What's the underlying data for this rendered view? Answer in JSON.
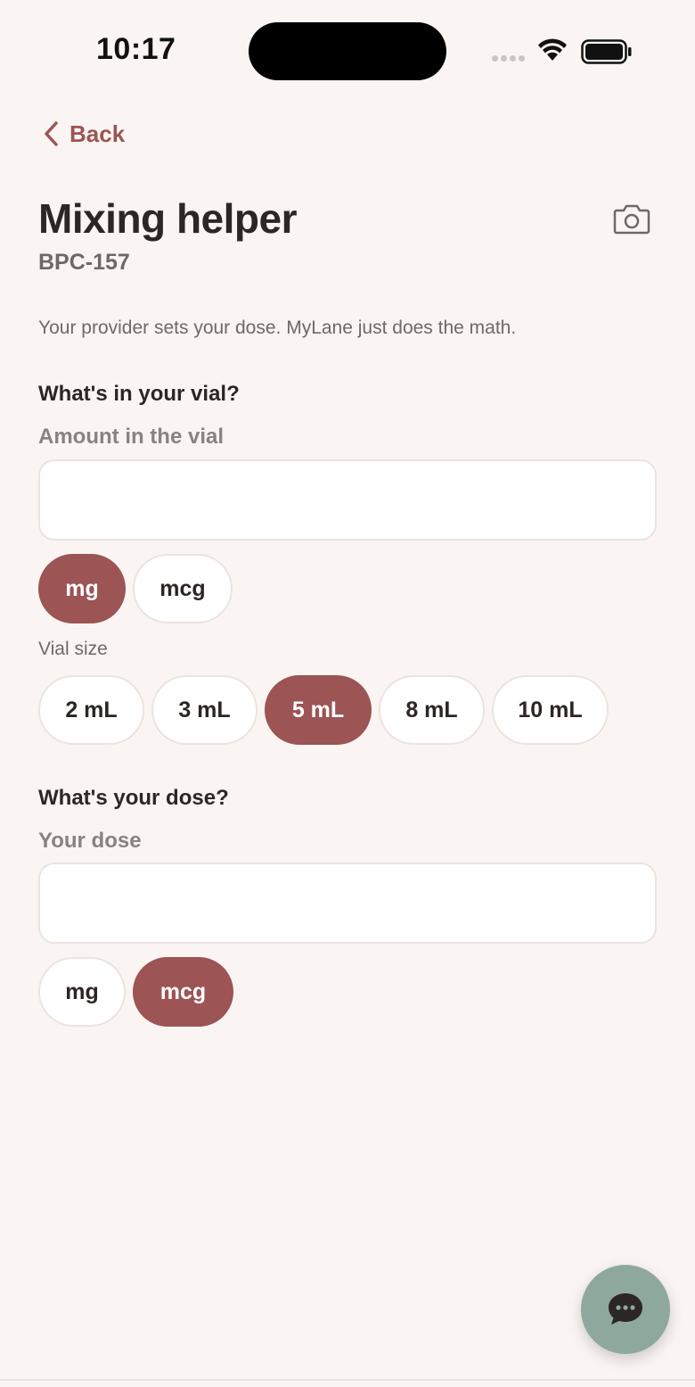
{
  "status_bar": {
    "time": "10:17"
  },
  "nav": {
    "back_label": "Back",
    "back_icon": "chevron-left-icon",
    "camera_icon": "camera-icon"
  },
  "header": {
    "title": "Mixing helper",
    "subtitle": "BPC-157"
  },
  "disclaimer": "Your provider sets your dose. MyLane just does the math.",
  "vial_section": {
    "heading": "What's in your vial?",
    "amount_label": "Amount in the vial",
    "amount_value": "",
    "amount_units": [
      {
        "label": "mg",
        "selected": true
      },
      {
        "label": "mcg",
        "selected": false
      }
    ],
    "vial_size_label": "Vial size",
    "vial_sizes": [
      {
        "label": "2 mL",
        "selected": false
      },
      {
        "label": "3 mL",
        "selected": false
      },
      {
        "label": "5 mL",
        "selected": true
      },
      {
        "label": "8 mL",
        "selected": false
      },
      {
        "label": "10 mL",
        "selected": false
      }
    ]
  },
  "dose_section": {
    "heading": "What's your dose?",
    "dose_label": "Your dose",
    "dose_value": "",
    "dose_units": [
      {
        "label": "mg",
        "selected": false
      },
      {
        "label": "mcg",
        "selected": true
      }
    ]
  },
  "chat_fab": {
    "icon": "chat-bubble-icon"
  },
  "colors": {
    "background": "#faf5f2",
    "accent": "#9c5455",
    "fab": "#8fa89d",
    "text_primary": "#2c2624",
    "text_secondary": "#6f6866"
  }
}
